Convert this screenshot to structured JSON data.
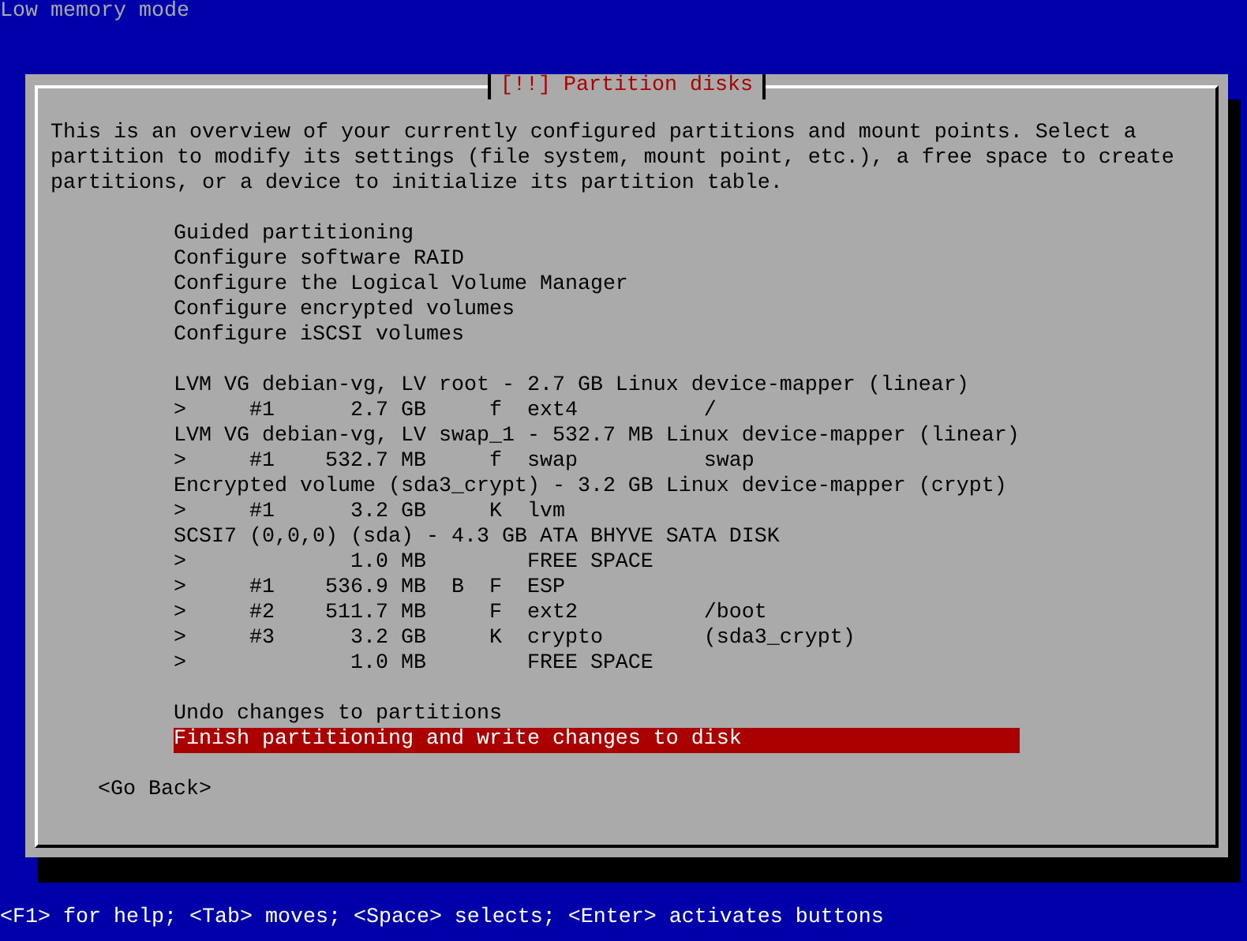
{
  "status_line": "Low memory mode",
  "dialog": {
    "title": "[!!] Partition disks",
    "description": "This is an overview of your currently configured partitions and mount points. Select a partition to modify its settings (file system, mount point, etc.), a free space to create partitions, or a device to initialize its partition table.",
    "menu_groups": [
      [
        {
          "text": "Guided partitioning",
          "selected": false
        },
        {
          "text": "Configure software RAID",
          "selected": false
        },
        {
          "text": "Configure the Logical Volume Manager",
          "selected": false
        },
        {
          "text": "Configure encrypted volumes",
          "selected": false
        },
        {
          "text": "Configure iSCSI volumes",
          "selected": false
        }
      ],
      [
        {
          "text": "LVM VG debian-vg, LV root - 2.7 GB Linux device-mapper (linear)",
          "selected": false
        },
        {
          "text": ">     #1      2.7 GB     f  ext4          /",
          "selected": false
        },
        {
          "text": "LVM VG debian-vg, LV swap_1 - 532.7 MB Linux device-mapper (linear)",
          "selected": false
        },
        {
          "text": ">     #1    532.7 MB     f  swap          swap",
          "selected": false
        },
        {
          "text": "Encrypted volume (sda3_crypt) - 3.2 GB Linux device-mapper (crypt)",
          "selected": false
        },
        {
          "text": ">     #1      3.2 GB     K  lvm",
          "selected": false
        },
        {
          "text": "SCSI7 (0,0,0) (sda) - 4.3 GB ATA BHYVE SATA DISK",
          "selected": false
        },
        {
          "text": ">             1.0 MB        FREE SPACE",
          "selected": false
        },
        {
          "text": ">     #1    536.9 MB  B  F  ESP",
          "selected": false
        },
        {
          "text": ">     #2    511.7 MB     F  ext2          /boot",
          "selected": false
        },
        {
          "text": ">     #3      3.2 GB     K  crypto        (sda3_crypt)",
          "selected": false
        },
        {
          "text": ">             1.0 MB        FREE SPACE",
          "selected": false
        }
      ],
      [
        {
          "text": "Undo changes to partitions",
          "selected": false
        },
        {
          "text": "Finish partitioning and write changes to disk",
          "selected": true
        }
      ]
    ],
    "back_button": "<Go Back>"
  },
  "help_line": "<F1> for help; <Tab> moves; <Space> selects; <Enter> activates buttons"
}
